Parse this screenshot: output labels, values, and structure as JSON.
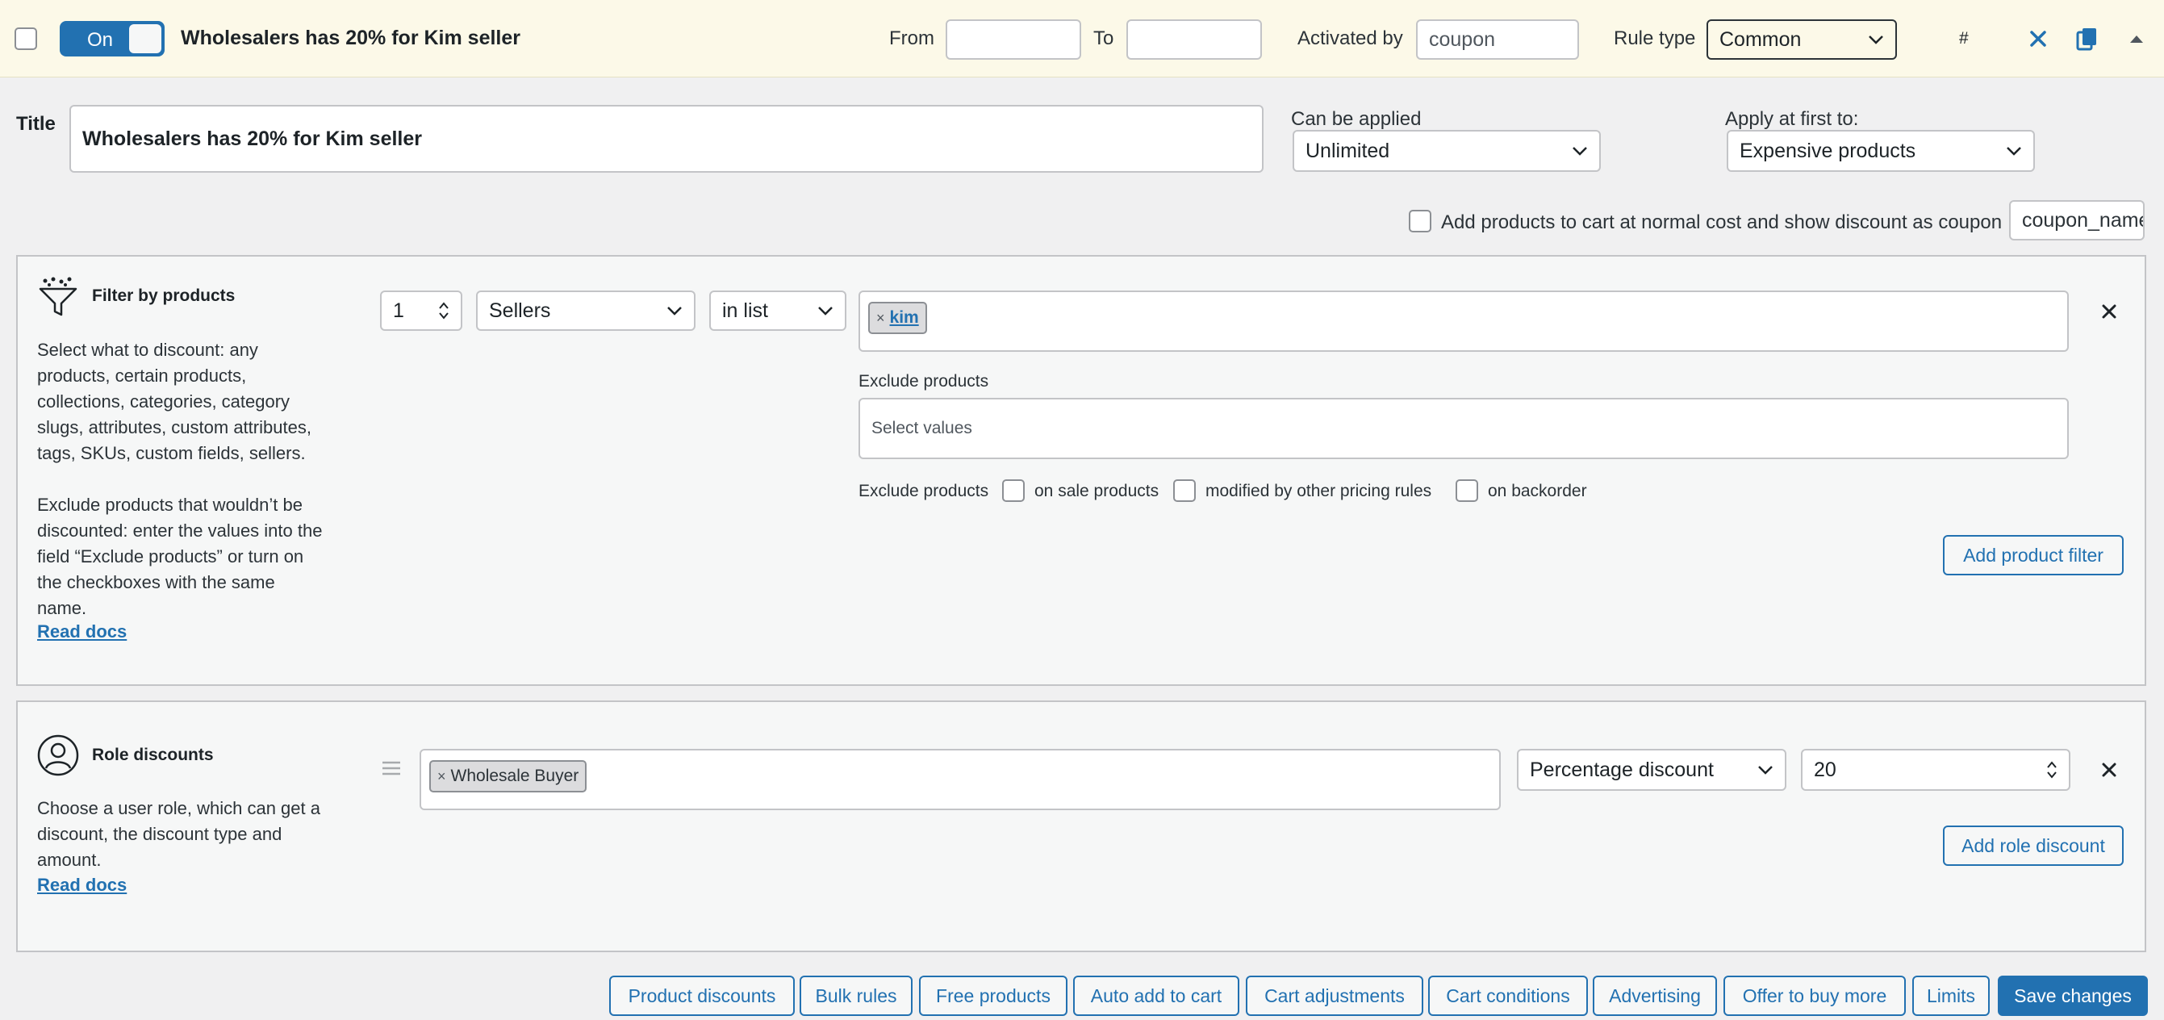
{
  "header": {
    "enabled_label": "On",
    "title": "Wholesalers has 20% for Kim seller",
    "from_label": "From",
    "from_value": "",
    "to_label": "To",
    "to_value": "",
    "activated_by_label": "Activated by",
    "activated_by_value": "coupon",
    "rule_type_label": "Rule type",
    "rule_type_value": "Common",
    "hash_label": "#"
  },
  "settings": {
    "title_label": "Title",
    "title_value": "Wholesalers has 20% for Kim seller",
    "can_be_applied_label": "Can be applied",
    "can_be_applied_value": "Unlimited",
    "apply_first_label": "Apply at first to:",
    "apply_first_value": "Expensive products",
    "coupon_checkbox_label": "Add products to cart at normal cost and show discount as coupon",
    "coupon_name_value": "coupon_name"
  },
  "filter": {
    "title": "Filter by products",
    "description_1": [
      "Select what to discount: any",
      "products, certain products,",
      "collections, categories, category",
      "slugs, attributes, custom attributes,",
      "tags, SKUs, custom fields, sellers."
    ],
    "description_2": [
      "Exclude products that wouldn’t be",
      "discounted: enter the values into the",
      "field “Exclude products” or turn on",
      "the checkboxes with the same",
      "name."
    ],
    "read_docs": "Read docs",
    "qty_value": "1",
    "type_value": "Sellers",
    "method_value": "in list",
    "tags": [
      "kim"
    ],
    "exclude_label": "Exclude products",
    "exclude_placeholder": "Select values",
    "exclude_inline_label": "Exclude products",
    "on_sale_label": "on sale products",
    "modified_label": "modified by other pricing rules",
    "backorder_label": "on backorder",
    "add_filter_label": "Add product filter"
  },
  "role": {
    "title": "Role discounts",
    "description": [
      "Choose a user role, which can get a",
      "discount, the discount type and",
      "amount."
    ],
    "read_docs": "Read docs",
    "tags": [
      "Wholesale Buyer"
    ],
    "discount_type_value": "Percentage discount",
    "amount_value": "20",
    "add_role_label": "Add role discount"
  },
  "footer": {
    "buttons": [
      "Product discounts",
      "Bulk rules",
      "Free products",
      "Auto add to cart",
      "Cart adjustments",
      "Cart conditions",
      "Advertising",
      "Offer to buy more",
      "Limits"
    ],
    "save_label": "Save changes"
  },
  "colors": {
    "accent": "#2271b1",
    "header_bg": "#fcf9e8",
    "panel_bg": "#f6f7f7",
    "border": "#c3c4c7"
  }
}
